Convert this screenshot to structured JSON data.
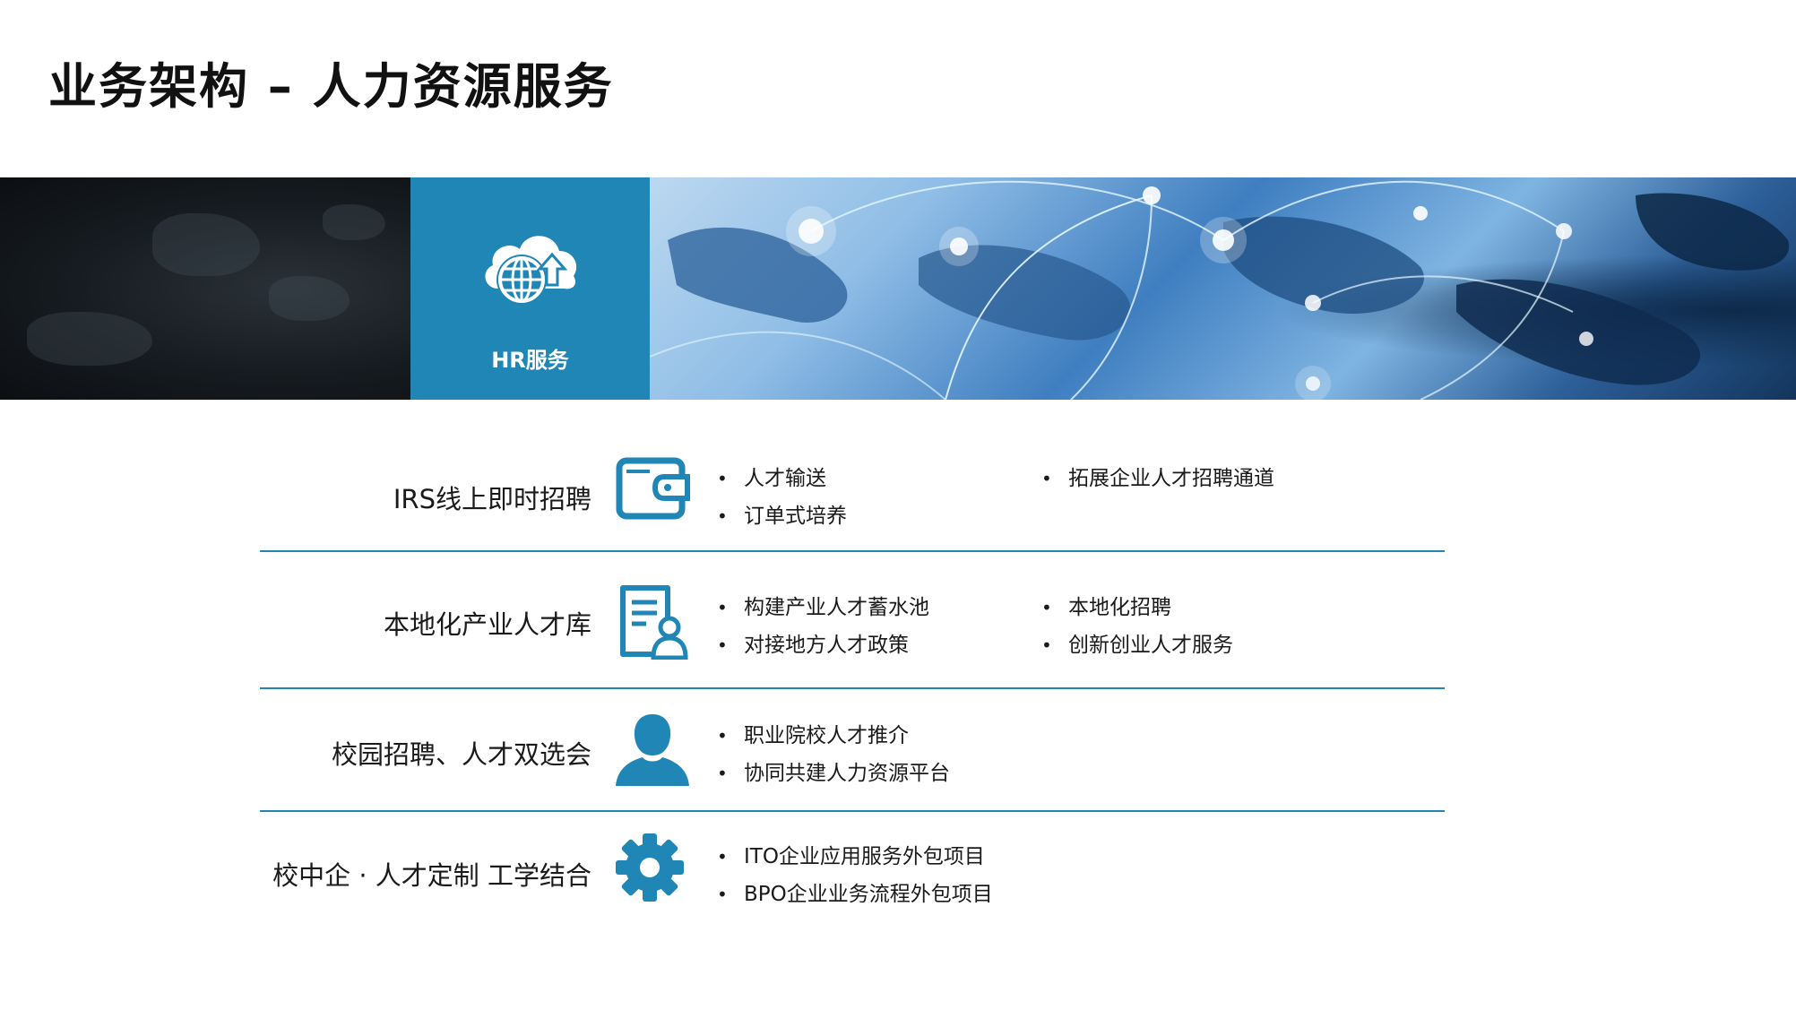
{
  "page": {
    "title": "业务架构 – 人力资源服务"
  },
  "banner": {
    "tile_label": "HR服务",
    "tile_icon": "cloud-globe-upload-icon",
    "accent_color": "#1f86b6"
  },
  "rows": [
    {
      "title": "IRS线上即时招聘",
      "icon": "wallet-icon",
      "bullets_left": [
        "人才输送",
        "订单式培养"
      ],
      "bullets_right": [
        "拓展企业人才招聘通道"
      ]
    },
    {
      "title": "本地化产业人才库",
      "icon": "resume-user-icon",
      "bullets_left": [
        "构建产业人才蓄水池",
        "对接地方人才政策"
      ],
      "bullets_right": [
        "本地化招聘",
        "创新创业人才服务"
      ]
    },
    {
      "title": "校园招聘、人才双选会",
      "icon": "person-icon",
      "bullets_left": [
        "职业院校人才推介",
        "协同共建人力资源平台"
      ],
      "bullets_right": []
    },
    {
      "title": "校中企 · 人才定制 工学结合",
      "icon": "gear-icon",
      "bullets_left": [
        "ITO企业应用服务外包项目",
        "BPO企业业务流程外包项目"
      ],
      "bullets_right": []
    }
  ]
}
